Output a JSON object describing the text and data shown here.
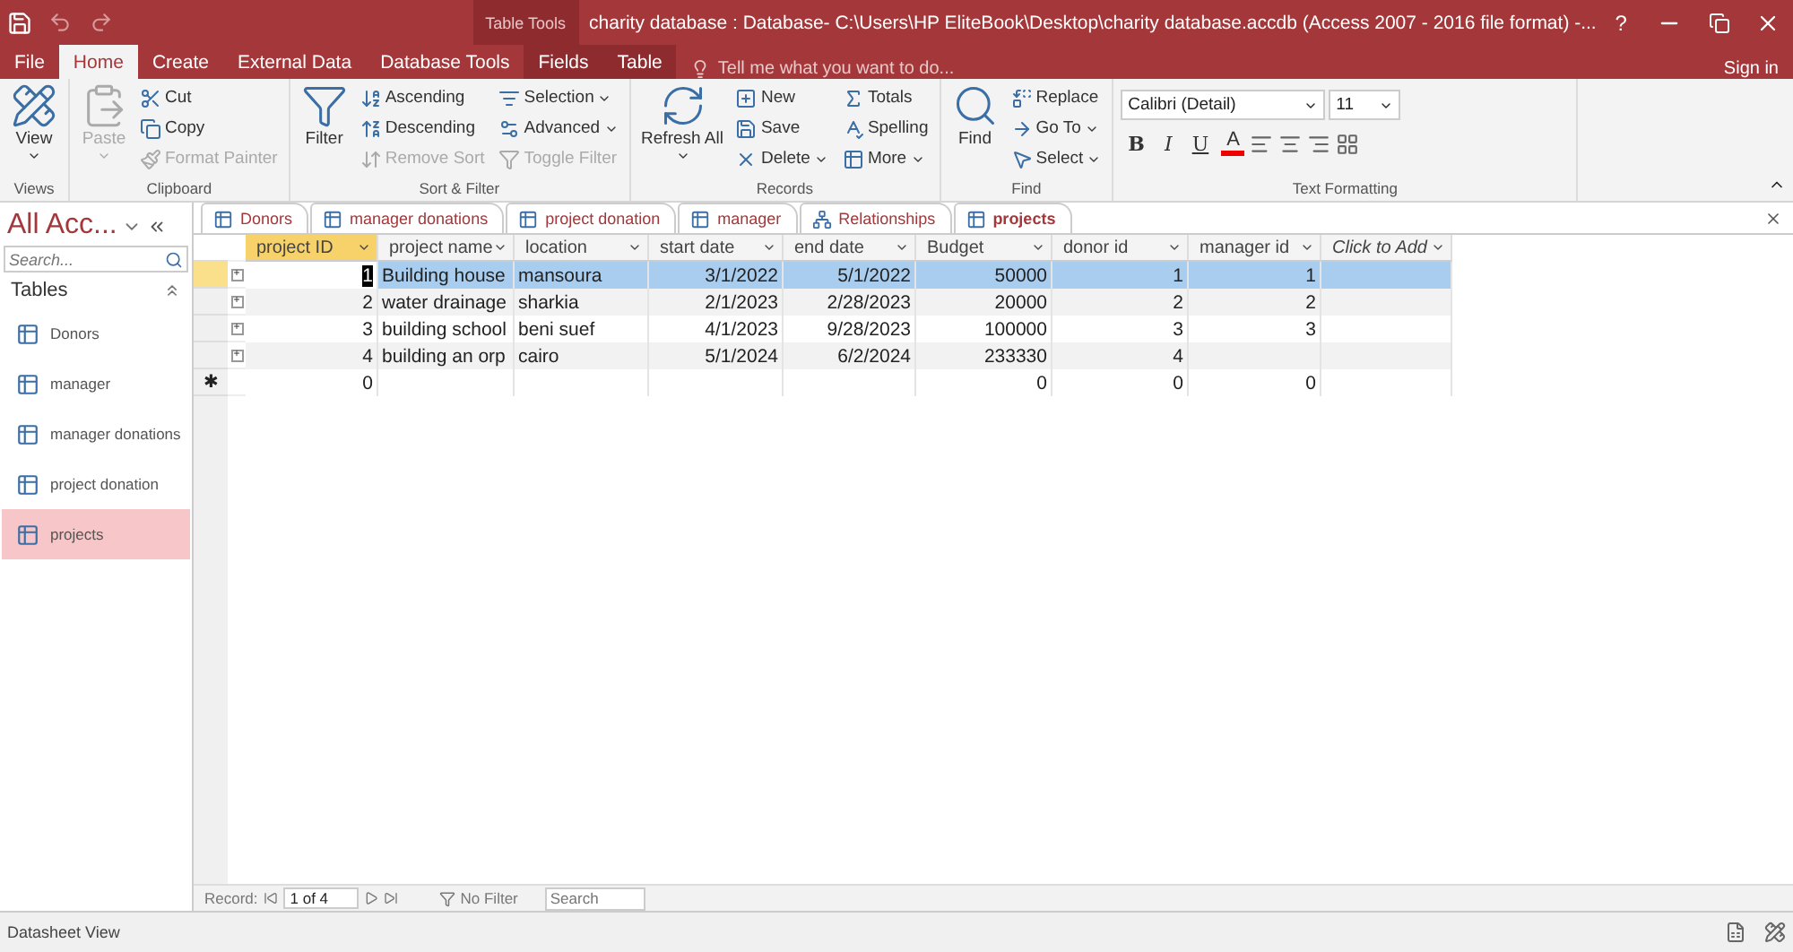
{
  "title_bar": {
    "context_label": "Table Tools",
    "title": "charity database : Database- C:\\Users\\HP EliteBook\\Desktop\\charity database.accdb (Access 2007 - 2016 file format) -...",
    "help": "?"
  },
  "ribbon_tabs": [
    {
      "label": "File",
      "selected": false,
      "kind": "normal"
    },
    {
      "label": "Home",
      "selected": true,
      "kind": "normal"
    },
    {
      "label": "Create",
      "selected": false,
      "kind": "normal"
    },
    {
      "label": "External Data",
      "selected": false,
      "kind": "normal"
    },
    {
      "label": "Database Tools",
      "selected": false,
      "kind": "normal"
    },
    {
      "label": "Fields",
      "selected": false,
      "kind": "contextual"
    },
    {
      "label": "Table",
      "selected": false,
      "kind": "contextual"
    }
  ],
  "tell_me": {
    "placeholder": "Tell me what you want to do..."
  },
  "sign_in": "Sign in",
  "ribbon_groups": [
    {
      "name": "Views",
      "kind": "commands",
      "commands": [
        {
          "label": "View",
          "kind": "large",
          "disabled": false,
          "dropdown": true
        }
      ]
    },
    {
      "name": "Clipboard",
      "kind": "commands",
      "commands": [
        {
          "label": "Paste",
          "kind": "large",
          "disabled": true,
          "dropdown": true
        },
        {
          "label": "Cut",
          "kind": "small",
          "disabled": false,
          "dropdown": false
        },
        {
          "label": "Copy",
          "kind": "small",
          "disabled": false,
          "dropdown": false
        },
        {
          "label": "Format Painter",
          "kind": "small",
          "disabled": true,
          "dropdown": false
        }
      ]
    },
    {
      "name": "Sort & Filter",
      "kind": "commands",
      "commands": [
        {
          "label": "Filter",
          "kind": "large",
          "disabled": false,
          "dropdown": false
        },
        {
          "label": "Ascending",
          "kind": "small",
          "disabled": false,
          "dropdown": false
        },
        {
          "label": "Descending",
          "kind": "small",
          "disabled": false,
          "dropdown": false
        },
        {
          "label": "Remove Sort",
          "kind": "small",
          "disabled": true,
          "dropdown": false
        },
        {
          "label": "Selection",
          "kind": "small",
          "disabled": false,
          "dropdown": true
        },
        {
          "label": "Advanced",
          "kind": "small",
          "disabled": false,
          "dropdown": true
        },
        {
          "label": "Toggle Filter",
          "kind": "small",
          "disabled": true,
          "dropdown": false
        }
      ]
    },
    {
      "name": "Records",
      "kind": "commands",
      "commands": [
        {
          "label": "Refresh All",
          "kind": "large",
          "disabled": false,
          "dropdown": true
        },
        {
          "label": "New",
          "kind": "small",
          "disabled": false,
          "dropdown": false
        },
        {
          "label": "Save",
          "kind": "small",
          "disabled": false,
          "dropdown": false
        },
        {
          "label": "Delete",
          "kind": "small",
          "disabled": false,
          "dropdown": true
        },
        {
          "label": "Totals",
          "kind": "small",
          "disabled": false,
          "dropdown": false
        },
        {
          "label": "Spelling",
          "kind": "small",
          "disabled": false,
          "dropdown": false
        },
        {
          "label": "More",
          "kind": "small",
          "disabled": false,
          "dropdown": true
        }
      ]
    },
    {
      "name": "Find",
      "kind": "commands",
      "commands": [
        {
          "label": "Find",
          "kind": "large",
          "disabled": false,
          "dropdown": false
        },
        {
          "label": "Replace",
          "kind": "small",
          "disabled": false,
          "dropdown": false
        },
        {
          "label": "Go To",
          "kind": "small",
          "disabled": false,
          "dropdown": true
        },
        {
          "label": "Select",
          "kind": "small",
          "disabled": false,
          "dropdown": true
        }
      ]
    },
    {
      "name": "Text Formatting",
      "kind": "formatting",
      "font": "Calibri (Detail)",
      "size": "11",
      "styles": [
        "B",
        "I",
        "U"
      ],
      "font_color": "A"
    }
  ],
  "nav_pane": {
    "title": "All Acc...",
    "search": {
      "placeholder": "Search..."
    },
    "section": "Tables",
    "items": [
      {
        "label": "Donors",
        "selected": false
      },
      {
        "label": "manager",
        "selected": false
      },
      {
        "label": "manager donations",
        "selected": false
      },
      {
        "label": "project donation",
        "selected": false
      },
      {
        "label": "projects",
        "selected": true
      }
    ]
  },
  "doc_tabs": [
    {
      "label": "Donors",
      "selected": false,
      "kind": "table"
    },
    {
      "label": "manager donations",
      "selected": false,
      "kind": "table"
    },
    {
      "label": "project donation",
      "selected": false,
      "kind": "table"
    },
    {
      "label": "manager",
      "selected": false,
      "kind": "table"
    },
    {
      "label": "Relationships",
      "selected": false,
      "kind": "relationships"
    },
    {
      "label": "projects",
      "selected": true,
      "kind": "table"
    }
  ],
  "datasheet": {
    "columns": [
      {
        "label": "project ID",
        "kind": "number",
        "selected": true
      },
      {
        "label": "project name",
        "kind": "text",
        "selected": false
      },
      {
        "label": "location",
        "kind": "text",
        "selected": false
      },
      {
        "label": "start date",
        "kind": "number",
        "selected": false
      },
      {
        "label": "end date",
        "kind": "number",
        "selected": false
      },
      {
        "label": "Budget",
        "kind": "number",
        "selected": false
      },
      {
        "label": "donor id",
        "kind": "number",
        "selected": false
      },
      {
        "label": "manager id",
        "kind": "number",
        "selected": false
      },
      {
        "label": "Click to Add",
        "kind": "add",
        "selected": false
      }
    ],
    "rows": [
      {
        "selected": true,
        "cells": [
          "1",
          "Building house",
          "mansoura",
          "3/1/2022",
          "5/1/2022",
          "50000",
          "1",
          "1"
        ]
      },
      {
        "selected": false,
        "cells": [
          "2",
          "water drainage",
          "sharkia",
          "2/1/2023",
          "2/28/2023",
          "20000",
          "2",
          "2"
        ]
      },
      {
        "selected": false,
        "cells": [
          "3",
          "building school",
          "beni suef",
          "4/1/2023",
          "9/28/2023",
          "100000",
          "3",
          "3"
        ]
      },
      {
        "selected": false,
        "cells": [
          "4",
          "building an orp",
          "cairo",
          "5/1/2024",
          "6/2/2024",
          "233330",
          "4",
          null
        ]
      }
    ],
    "expander": "+",
    "new_row": {
      "marker": "✱",
      "cells": [
        "0",
        null,
        null,
        null,
        null,
        "0",
        "0",
        "0"
      ]
    }
  },
  "record_nav": {
    "label": "Record:",
    "position": "1 of 4",
    "filter": "No Filter",
    "search": {
      "placeholder": "Search"
    }
  },
  "status_bar": "Datasheet View"
}
